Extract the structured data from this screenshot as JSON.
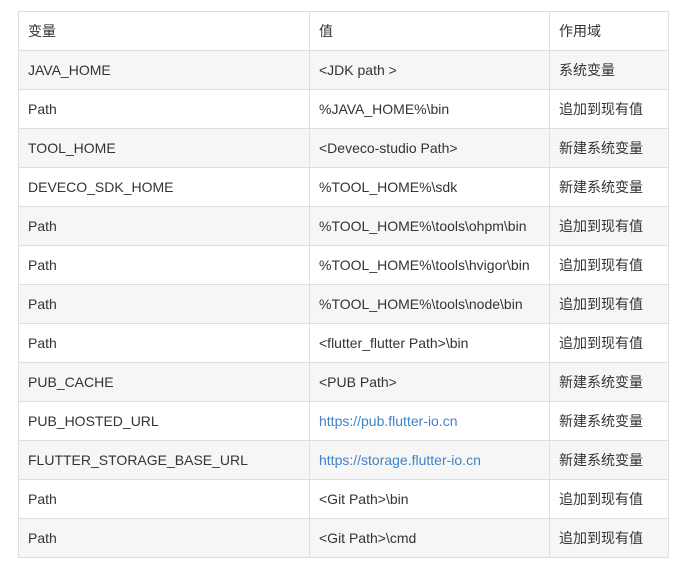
{
  "table": {
    "headers": [
      "变量",
      "值",
      "作用域"
    ],
    "rows": [
      {
        "variable": "JAVA_HOME",
        "value": "<JDK path >",
        "scope": "系统变量",
        "is_link": false
      },
      {
        "variable": "Path",
        "value": "%JAVA_HOME%\\bin",
        "scope": "追加到现有值",
        "is_link": false
      },
      {
        "variable": "TOOL_HOME",
        "value": "<Deveco-studio Path>",
        "scope": "新建系统变量",
        "is_link": false
      },
      {
        "variable": "DEVECO_SDK_HOME",
        "value": "%TOOL_HOME%\\sdk",
        "scope": "新建系统变量",
        "is_link": false
      },
      {
        "variable": "Path",
        "value": "%TOOL_HOME%\\tools\\ohpm\\bin",
        "scope": "追加到现有值",
        "is_link": false
      },
      {
        "variable": "Path",
        "value": "%TOOL_HOME%\\tools\\hvigor\\bin",
        "scope": "追加到现有值",
        "is_link": false
      },
      {
        "variable": "Path",
        "value": "%TOOL_HOME%\\tools\\node\\bin",
        "scope": "追加到现有值",
        "is_link": false
      },
      {
        "variable": "Path",
        "value": "<flutter_flutter Path>\\bin",
        "scope": "追加到现有值",
        "is_link": false
      },
      {
        "variable": "PUB_CACHE",
        "value": "<PUB Path>",
        "scope": "新建系统变量",
        "is_link": false
      },
      {
        "variable": "PUB_HOSTED_URL",
        "value": "https://pub.flutter-io.cn",
        "scope": "新建系统变量",
        "is_link": true
      },
      {
        "variable": "FLUTTER_STORAGE_BASE_URL",
        "value": "https://storage.flutter-io.cn",
        "scope": "新建系统变量",
        "is_link": true
      },
      {
        "variable": "Path",
        "value": "<Git Path>\\bin",
        "scope": "追加到现有值",
        "is_link": false
      },
      {
        "variable": "Path",
        "value": "<Git Path>\\cmd",
        "scope": "追加到现有值",
        "is_link": false
      }
    ]
  },
  "colors": {
    "link": "#4183c4",
    "border": "#dfdfdf",
    "stripe": "#f6f6f6",
    "text": "#333333"
  }
}
